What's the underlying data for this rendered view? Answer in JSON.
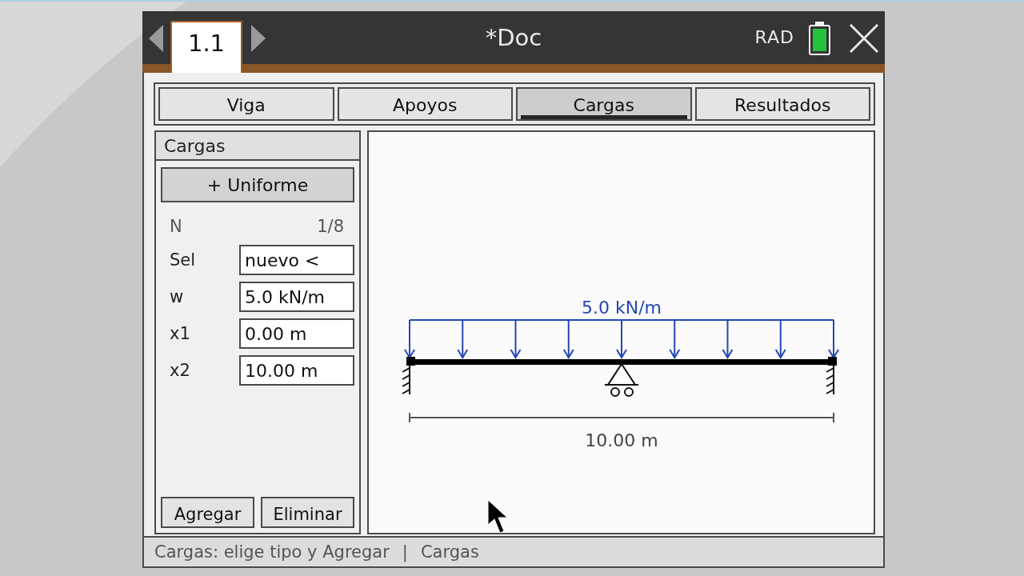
{
  "title_bar": {
    "page_tab": {
      "label": "1.1",
      "selected": true
    },
    "title": "*Doc",
    "angle_mode": "RAD"
  },
  "tabs": [
    {
      "label": "Viga",
      "selected": false
    },
    {
      "label": "Apoyos",
      "selected": false
    },
    {
      "label": "Cargas",
      "selected": true
    },
    {
      "label": "Resultados",
      "selected": false
    }
  ],
  "load_panel": {
    "header": "Cargas",
    "type_button": "+ Uniforme",
    "counter": {
      "label": "N",
      "value": "1/8"
    },
    "fields": [
      {
        "label": "Sel",
        "value": "nuevo <"
      },
      {
        "label": "w",
        "value": "5.0 kN/m"
      },
      {
        "label": "x1",
        "value": "0.00 m"
      },
      {
        "label": "x2",
        "value": "10.00 m"
      }
    ],
    "buttons": [
      {
        "label": "Agregar"
      },
      {
        "label": "Eliminar"
      }
    ]
  },
  "diagram": {
    "load": {
      "kind": "uniform",
      "label": "5.0 kN/m"
    },
    "supports": [
      {
        "kind": "fixed"
      },
      {
        "kind": "roller"
      },
      {
        "kind": "fixed"
      }
    ],
    "span_label": "10.00 m"
  },
  "status_bar": {
    "hint": "Cargas: elige tipo y Agregar",
    "separator": "|",
    "section": "Cargas"
  }
}
